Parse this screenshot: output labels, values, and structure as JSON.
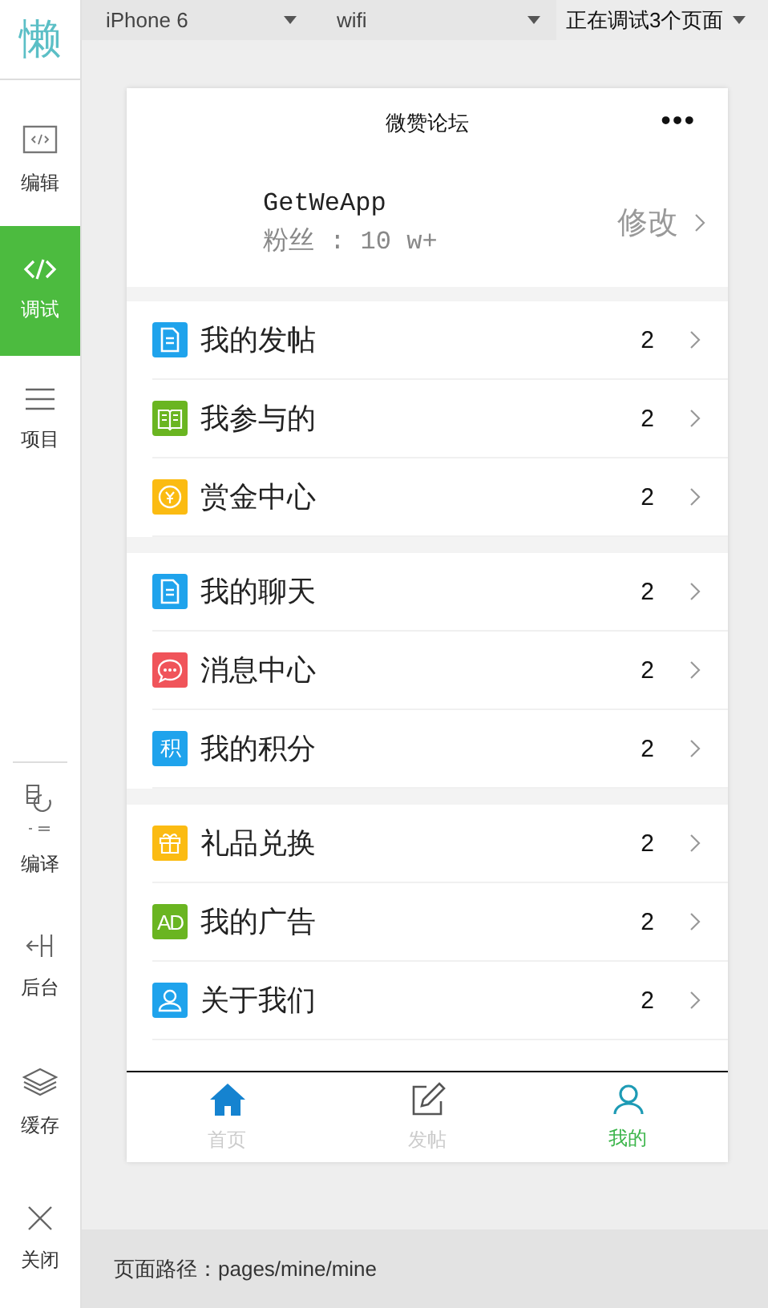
{
  "sidebar": {
    "logo": "懒",
    "top_items": [
      {
        "label": "编辑",
        "kind": "code-box",
        "selected": false
      },
      {
        "label": "调试",
        "kind": "code",
        "selected": true
      },
      {
        "label": "项目",
        "kind": "lines",
        "selected": false
      }
    ],
    "bottom_items": [
      {
        "label": "编译",
        "kind": "compile",
        "selected": false
      },
      {
        "label": "后台",
        "kind": "backend",
        "selected": false
      },
      {
        "label": "缓存",
        "kind": "layers",
        "selected": false
      },
      {
        "label": "关闭",
        "kind": "close",
        "selected": false
      }
    ]
  },
  "toolbar": {
    "device": "iPhone 6",
    "network": "wifi",
    "status": "正在调试3个页面"
  },
  "phone": {
    "title": "微赞论坛",
    "menu": "•••",
    "profile": {
      "name": "GetWeApp",
      "fans": "粉丝 : 10 w+",
      "edit": "修改"
    },
    "groups": [
      [
        {
          "label": "我的发帖",
          "count": "2",
          "kind": "doc",
          "color": "#1fa3ec"
        },
        {
          "label": "我参与的",
          "count": "2",
          "kind": "book",
          "color": "#6ab521"
        },
        {
          "label": "赏金中心",
          "count": "2",
          "kind": "coin",
          "color": "#fbbb12"
        }
      ],
      [
        {
          "label": "我的聊天",
          "count": "2",
          "kind": "doc",
          "color": "#1fa3ec"
        },
        {
          "label": "消息中心",
          "count": "2",
          "kind": "chat",
          "color": "#f0545a"
        },
        {
          "label": "我的积分",
          "count": "2",
          "kind": "badge",
          "badge": "积",
          "color": "#1fa3ec"
        }
      ],
      [
        {
          "label": "礼品兑换",
          "count": "2",
          "kind": "gift",
          "color": "#fbbb12"
        },
        {
          "label": "我的广告",
          "count": "2",
          "kind": "badge",
          "badge": "AD",
          "color": "#6ab521"
        },
        {
          "label": "关于我们",
          "count": "2",
          "kind": "person",
          "color": "#1fa3ec"
        }
      ]
    ],
    "tabs": [
      {
        "label": "首页",
        "kind": "home",
        "selected": false
      },
      {
        "label": "发帖",
        "kind": "edit",
        "selected": false
      },
      {
        "label": "我的",
        "kind": "user",
        "selected": true
      }
    ]
  },
  "footer": {
    "path": "页面路径：pages/mine/mine"
  }
}
